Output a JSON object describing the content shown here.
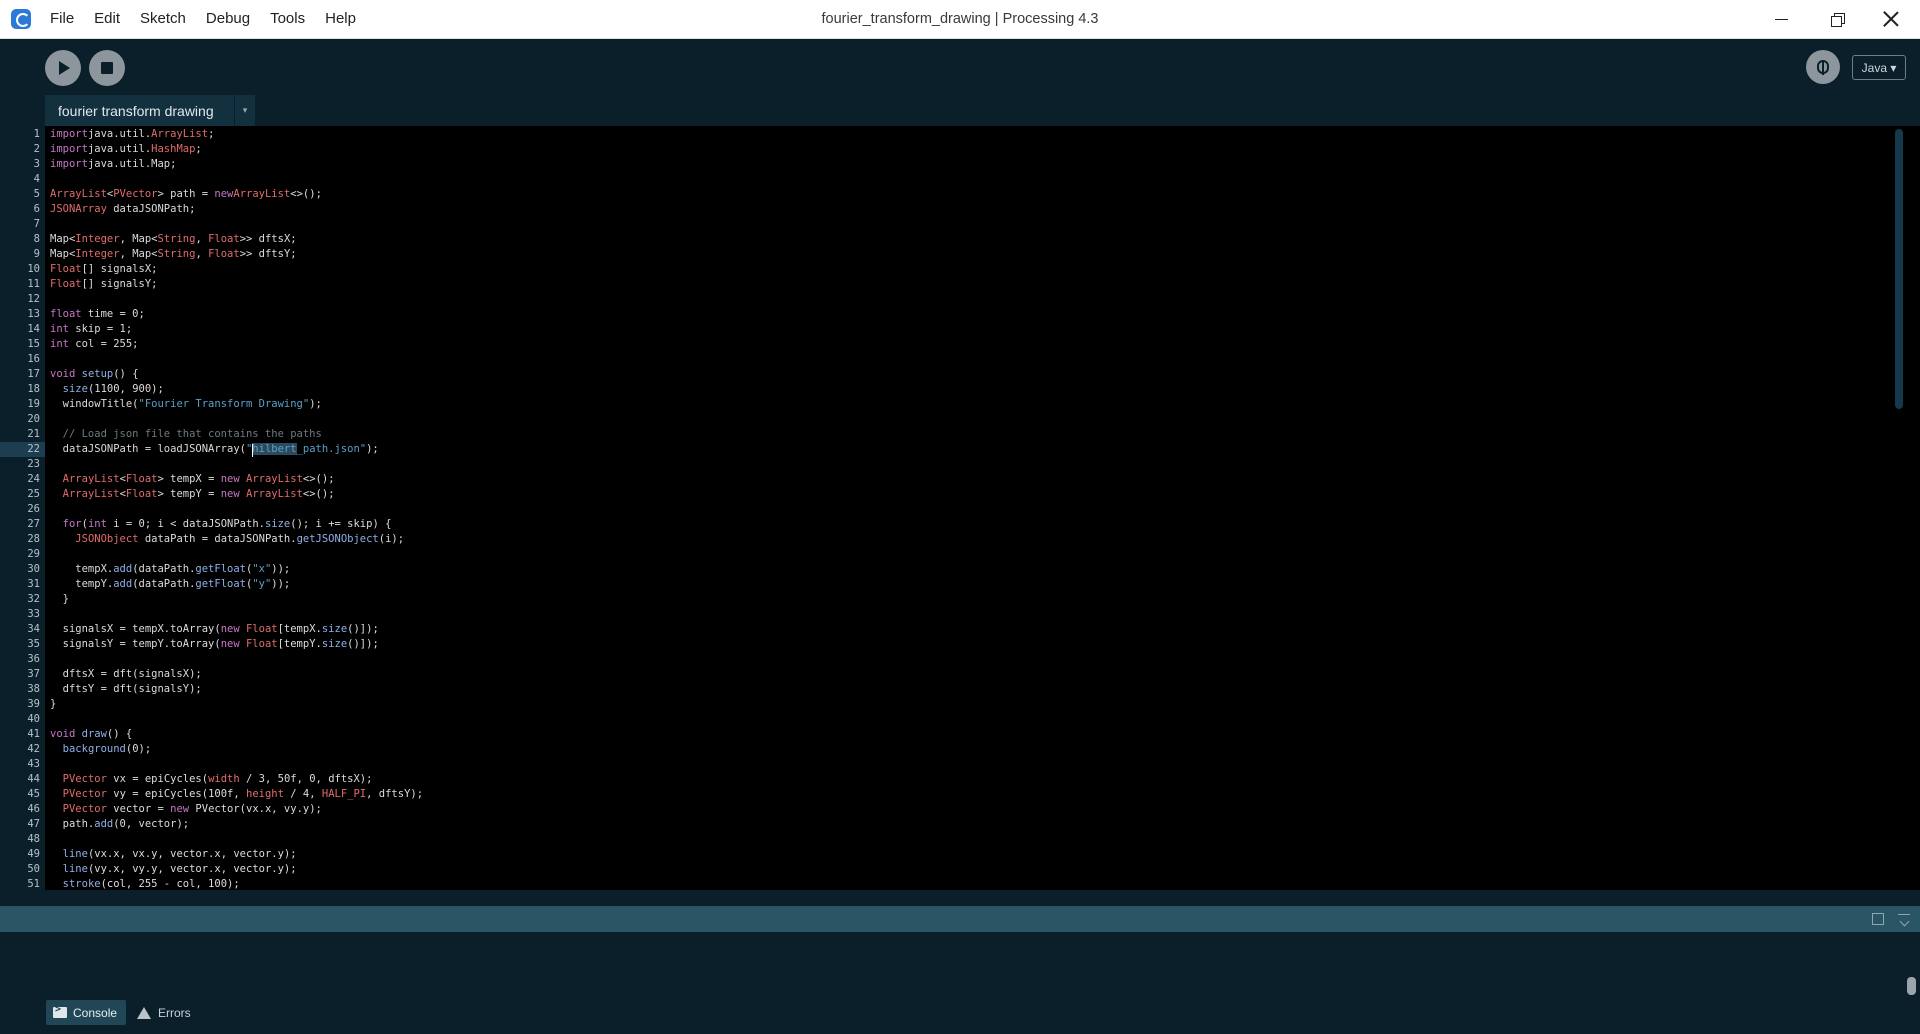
{
  "window": {
    "title": "fourier_transform_drawing | Processing 4.3"
  },
  "menu": [
    "File",
    "Edit",
    "Sketch",
    "Debug",
    "Tools",
    "Help"
  ],
  "toolbar": {
    "mode": "Java ▾"
  },
  "tab": {
    "label": "fourier transform drawing",
    "menu_glyph": "▾"
  },
  "editor": {
    "current_line": 22,
    "lines": [
      [
        [
          "kw",
          "import"
        ],
        [
          "",
          "java.util."
        ],
        [
          "ty",
          "ArrayList"
        ],
        [
          "",
          ";"
        ]
      ],
      [
        [
          "kw",
          "import"
        ],
        [
          "",
          "java.util."
        ],
        [
          "ty",
          "HashMap"
        ],
        [
          "",
          ";"
        ]
      ],
      [
        [
          "kw",
          "import"
        ],
        [
          "",
          "java.util.Map;"
        ]
      ],
      [],
      [
        [
          "ty",
          "ArrayList"
        ],
        [
          "",
          "<"
        ],
        [
          "ty",
          "PVector"
        ],
        [
          "",
          "> path = "
        ],
        [
          "kw",
          "new"
        ],
        [
          "ty",
          "ArrayList"
        ],
        [
          "",
          "<>();"
        ]
      ],
      [
        [
          "ty",
          "JSONArray"
        ],
        [
          "",
          " dataJSONPath;"
        ]
      ],
      [],
      [
        [
          "",
          "Map<"
        ],
        [
          "ty",
          "Integer"
        ],
        [
          "",
          ", Map<"
        ],
        [
          "ty",
          "String"
        ],
        [
          "",
          ", "
        ],
        [
          "ty",
          "Float"
        ],
        [
          "",
          ">> dftsX;"
        ]
      ],
      [
        [
          "",
          "Map<"
        ],
        [
          "ty",
          "Integer"
        ],
        [
          "",
          ", Map<"
        ],
        [
          "ty",
          "String"
        ],
        [
          "",
          ", "
        ],
        [
          "ty",
          "Float"
        ],
        [
          "",
          ">> dftsY;"
        ]
      ],
      [
        [
          "ty",
          "Float"
        ],
        [
          "",
          "[] signalsX;"
        ]
      ],
      [
        [
          "ty",
          "Float"
        ],
        [
          "",
          "[] signalsY;"
        ]
      ],
      [],
      [
        [
          "kw",
          "float"
        ],
        [
          "",
          " time = 0;"
        ]
      ],
      [
        [
          "kw",
          "int"
        ],
        [
          "",
          " skip = 1;"
        ]
      ],
      [
        [
          "kw",
          "int"
        ],
        [
          "",
          " col = 255;"
        ]
      ],
      [],
      [
        [
          "kw",
          "void"
        ],
        [
          "fn",
          " setup"
        ],
        [
          "",
          "() {"
        ]
      ],
      [
        [
          "",
          "  "
        ],
        [
          "fn",
          "size"
        ],
        [
          "",
          "(1100, 900);"
        ]
      ],
      [
        [
          "",
          "  windowTitle("
        ],
        [
          "str",
          "\"Fourier Transform Drawing\""
        ],
        [
          "",
          ");"
        ]
      ],
      [],
      [
        [
          "cm",
          "  // Load json file that contains the paths"
        ]
      ],
      [
        [
          "",
          "  dataJSONPath = loadJSONArray("
        ],
        [
          "str",
          "\""
        ],
        [
          "sel",
          "hilbert"
        ],
        [
          "str",
          "_path.json\""
        ],
        [
          "",
          ");"
        ]
      ],
      [],
      [
        [
          "",
          "  "
        ],
        [
          "ty",
          "ArrayList"
        ],
        [
          "",
          "<"
        ],
        [
          "ty",
          "Float"
        ],
        [
          "",
          "> tempX = "
        ],
        [
          "kw",
          "new"
        ],
        [
          "ty",
          " ArrayList"
        ],
        [
          "",
          "<>();"
        ]
      ],
      [
        [
          "",
          "  "
        ],
        [
          "ty",
          "ArrayList"
        ],
        [
          "",
          "<"
        ],
        [
          "ty",
          "Float"
        ],
        [
          "",
          "> tempY = "
        ],
        [
          "kw",
          "new"
        ],
        [
          "ty",
          " ArrayList"
        ],
        [
          "",
          "<>();"
        ]
      ],
      [],
      [
        [
          "",
          "  "
        ],
        [
          "kw",
          "for"
        ],
        [
          "",
          "("
        ],
        [
          "kw",
          "int"
        ],
        [
          "",
          " i = 0; i < dataJSONPath."
        ],
        [
          "fn",
          "size"
        ],
        [
          "",
          "(); i += skip) {"
        ]
      ],
      [
        [
          "",
          "    "
        ],
        [
          "ty",
          "JSONObject"
        ],
        [
          "",
          " dataPath = dataJSONPath."
        ],
        [
          "fn",
          "getJSONObject"
        ],
        [
          "",
          "(i);"
        ]
      ],
      [],
      [
        [
          "",
          "    tempX."
        ],
        [
          "fn",
          "add"
        ],
        [
          "",
          "(dataPath."
        ],
        [
          "fn",
          "getFloat"
        ],
        [
          "",
          "("
        ],
        [
          "str",
          "\"x\""
        ],
        [
          "",
          "));"
        ]
      ],
      [
        [
          "",
          "    tempY."
        ],
        [
          "fn",
          "add"
        ],
        [
          "",
          "(dataPath."
        ],
        [
          "fn",
          "getFloat"
        ],
        [
          "",
          "("
        ],
        [
          "str",
          "\"y\""
        ],
        [
          "",
          "));"
        ]
      ],
      [
        [
          "",
          "  }"
        ]
      ],
      [],
      [
        [
          "",
          "  signalsX = tempX.toArray("
        ],
        [
          "kw",
          "new"
        ],
        [
          "ty",
          " Float"
        ],
        [
          "",
          "[tempX."
        ],
        [
          "fn",
          "size"
        ],
        [
          "",
          "()]);"
        ]
      ],
      [
        [
          "",
          "  signalsY = tempY.toArray("
        ],
        [
          "kw",
          "new"
        ],
        [
          "ty",
          " Float"
        ],
        [
          "",
          "[tempY."
        ],
        [
          "fn",
          "size"
        ],
        [
          "",
          "()]);"
        ]
      ],
      [],
      [
        [
          "",
          "  dftsX = dft(signalsX);"
        ]
      ],
      [
        [
          "",
          "  dftsY = dft(signalsY);"
        ]
      ],
      [
        [
          "",
          "}"
        ]
      ],
      [],
      [
        [
          "kw",
          "void"
        ],
        [
          "fn",
          " draw"
        ],
        [
          "",
          "() {"
        ]
      ],
      [
        [
          "",
          "  "
        ],
        [
          "fn",
          "background"
        ],
        [
          "",
          "(0);"
        ]
      ],
      [],
      [
        [
          "",
          "  "
        ],
        [
          "ty",
          "PVector"
        ],
        [
          "",
          " vx = epiCycles("
        ],
        [
          "ty",
          "width"
        ],
        [
          "",
          " / 3, 50f, 0, dftsX);"
        ]
      ],
      [
        [
          "",
          "  "
        ],
        [
          "ty",
          "PVector"
        ],
        [
          "",
          " vy = epiCycles(100f, "
        ],
        [
          "ty",
          "height"
        ],
        [
          "",
          " / 4, "
        ],
        [
          "ty",
          "HALF_PI"
        ],
        [
          "",
          ", dftsY);"
        ]
      ],
      [
        [
          "",
          "  "
        ],
        [
          "ty",
          "PVector"
        ],
        [
          "",
          " vector = "
        ],
        [
          "kw",
          "new"
        ],
        [
          "",
          " PVector(vx.x, vy.y);"
        ]
      ],
      [
        [
          "",
          "  path."
        ],
        [
          "fn",
          "add"
        ],
        [
          "",
          "(0, vector);"
        ]
      ],
      [],
      [
        [
          "",
          "  "
        ],
        [
          "fn",
          "line"
        ],
        [
          "",
          "(vx.x, vx.y, vector.x, vector.y);"
        ]
      ],
      [
        [
          "",
          "  "
        ],
        [
          "fn",
          "line"
        ],
        [
          "",
          "(vy.x, vy.y, vector.x, vector.y);"
        ]
      ],
      [
        [
          "",
          "  "
        ],
        [
          "fn",
          "stroke"
        ],
        [
          "",
          "(col, 255 - col, 100);"
        ]
      ]
    ]
  },
  "console": {
    "tabs": [
      "Console",
      "Errors"
    ]
  },
  "colors": {
    "background": "#0b1f2a",
    "editor_bg": "#000000",
    "keyword": "#c678c4",
    "type": "#e06c6c",
    "function": "#8fb0e8",
    "string": "#5aa0c8",
    "comment": "#6c7a82",
    "console_header": "#2a5565"
  }
}
